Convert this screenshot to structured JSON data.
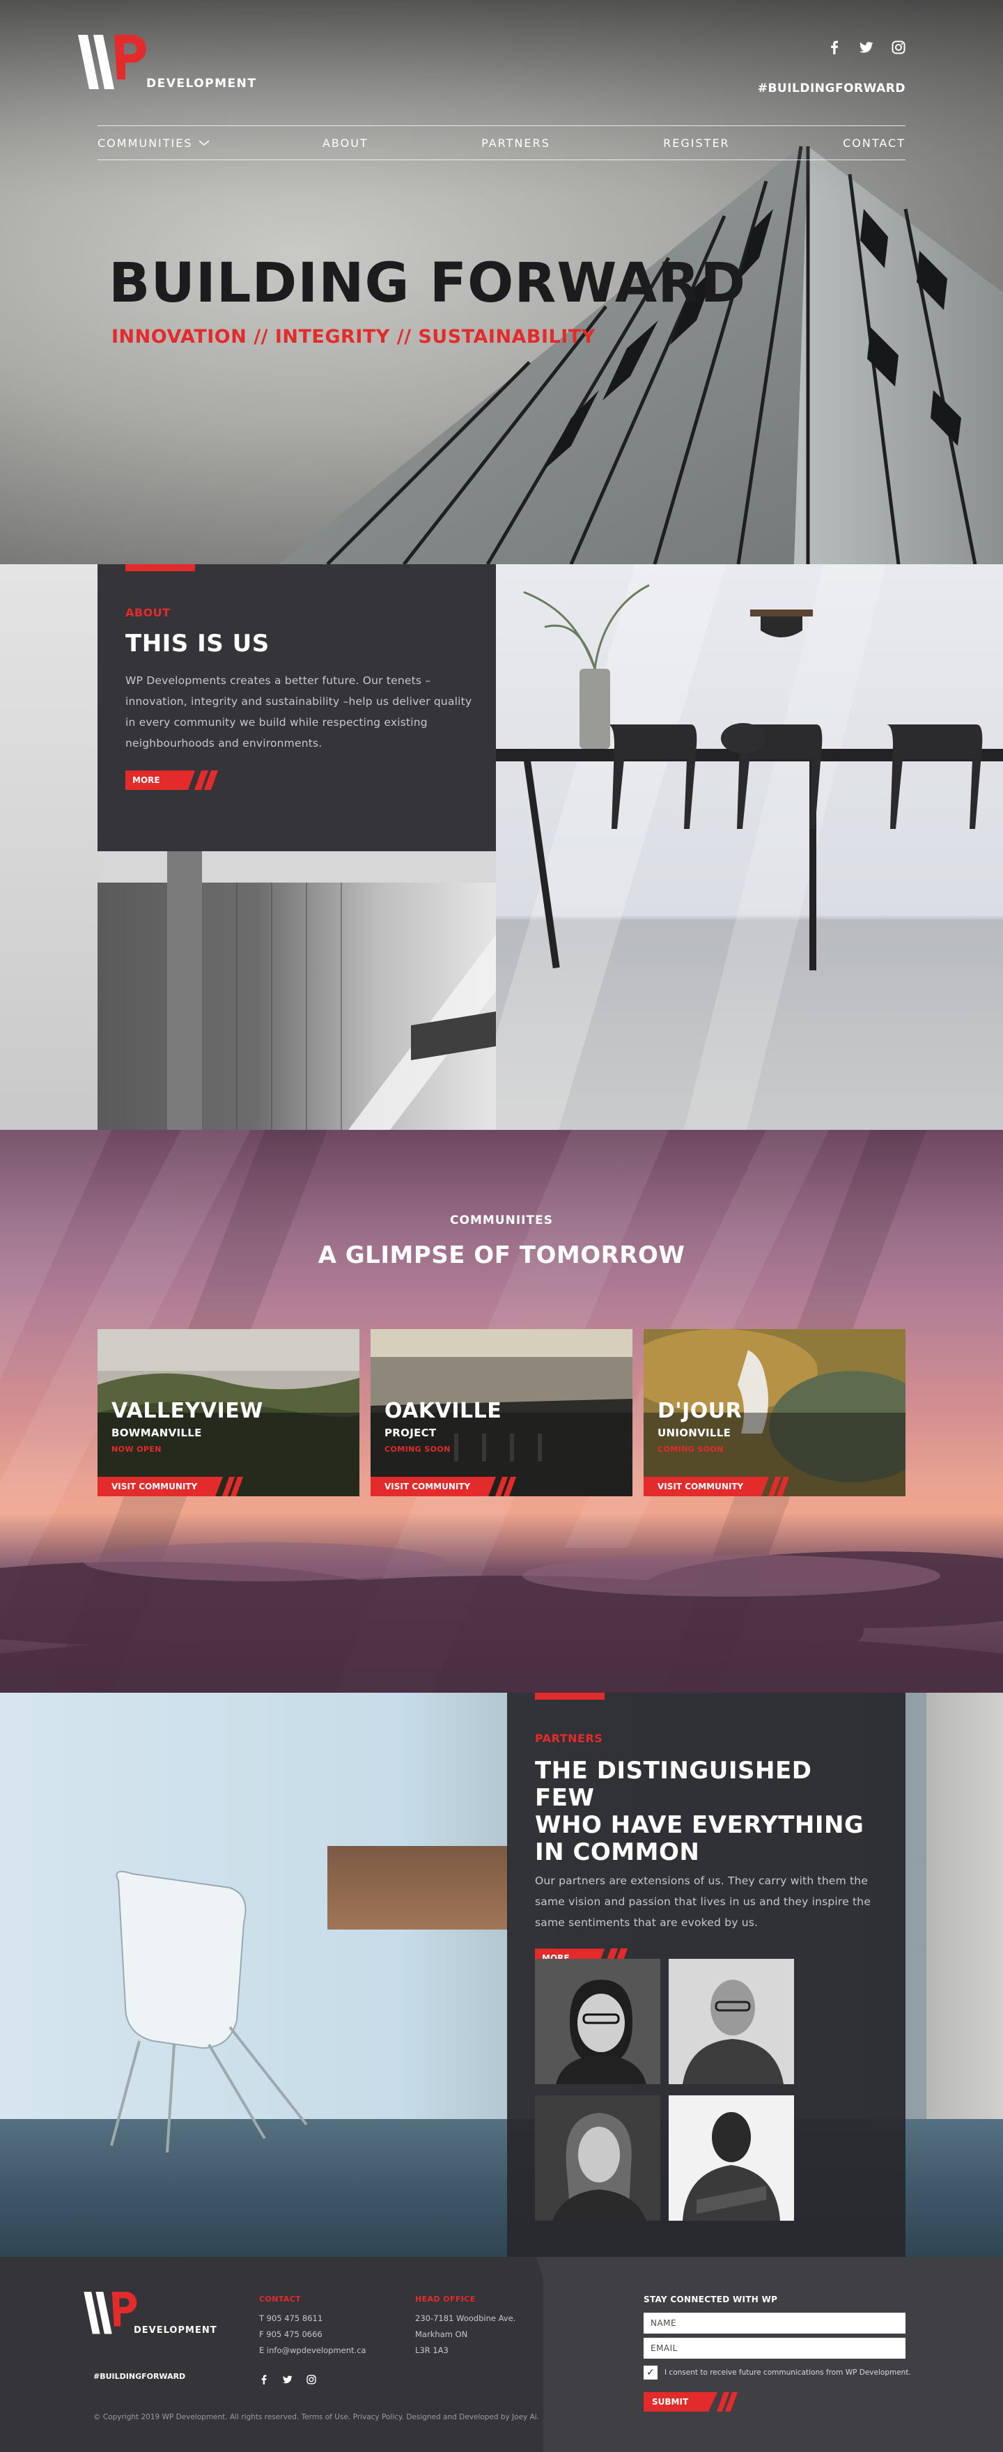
{
  "brand": {
    "logo_text": "DEVELOPMENT",
    "hashtag": "#BUILDINGFORWARD",
    "accent": "#e32b2b"
  },
  "header": {
    "social_icons": [
      "facebook-icon",
      "twitter-icon",
      "instagram-icon"
    ],
    "nav": [
      {
        "label": "COMMUNITIES"
      },
      {
        "label": "ABOUT"
      },
      {
        "label": "PARTNERS"
      },
      {
        "label": "REGISTER"
      },
      {
        "label": "CONTACT"
      }
    ]
  },
  "hero": {
    "title": "BUILDING FORWARD",
    "subtitle": "INNOVATION // INTEGRITY // SUSTAINABILITY"
  },
  "about": {
    "eyebrow": "ABOUT",
    "title": "THIS IS US",
    "body": "WP Developments creates a better future. Our tenets – innovation, integrity and sustainability –help us deliver quality in every community we build while respecting existing neighbourhoods and environments.",
    "more_label": "MORE"
  },
  "communities": {
    "eyebrow": "COMMUNIITES",
    "title": "A GLIMPSE OF TOMORROW",
    "cards": [
      {
        "name": "VALLEYVIEW",
        "sub": "BOWMANVILLE",
        "status": "NOW OPEN",
        "cta": "VISIT COMMUNITY"
      },
      {
        "name": "OAKVILLE",
        "sub": "PROJECT",
        "status": "COMING SOON",
        "cta": "VISIT COMMUNITY"
      },
      {
        "name": "D'JOUR",
        "sub": "UNIONVILLE",
        "status": "COMING SOON",
        "cta": "VISIT COMMUNITY"
      }
    ]
  },
  "partners": {
    "eyebrow": "PARTNERS",
    "title_lines": [
      "THE DISTINGUISHED FEW",
      "WHO HAVE EVERYTHING",
      "IN COMMON"
    ],
    "body": "Our partners are extensions of us. They carry with them the same vision and passion that lives in us and they inspire the same sentiments that are evoked by us.",
    "more_label": "MORE"
  },
  "footer": {
    "hashtag": "#BUILDINGFORWARD",
    "contact": {
      "head": "CONTACT",
      "lines": [
        "T 905 475 8611",
        "F 905 475 0666",
        "E info@wpdevelopment.ca"
      ]
    },
    "office": {
      "head": "HEAD OFFICE",
      "lines": [
        "230-7181 Woodbine Ave.",
        "Markham  ON",
        "L3R 1A3"
      ]
    },
    "social_icons": [
      "facebook-icon",
      "twitter-icon",
      "instagram-icon"
    ],
    "newsletter": {
      "heading": "STAY CONNECTED WITH WP",
      "name_placeholder": "NAME",
      "email_placeholder": "EMAIL",
      "consent": "I consent to receive future communications from WP Development.",
      "submit": "SUBMIT"
    },
    "copyright": "© Copyright 2019 WP Development. All rights reserved. Terms of Use. Privacy Policy. Designed and Developed by Joey Ai."
  }
}
